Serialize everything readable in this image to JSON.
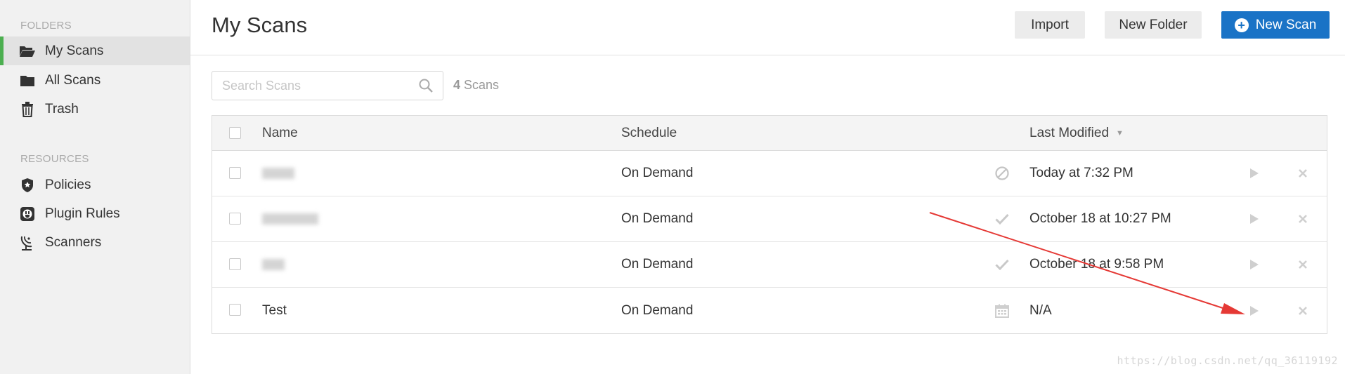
{
  "sidebar": {
    "folders_title": "FOLDERS",
    "resources_title": "RESOURCES",
    "folders": [
      {
        "label": "My Scans",
        "icon": "folder-open-icon",
        "active": true
      },
      {
        "label": "All Scans",
        "icon": "folder-icon",
        "active": false
      },
      {
        "label": "Trash",
        "icon": "trash-icon",
        "active": false
      }
    ],
    "resources": [
      {
        "label": "Policies",
        "icon": "shield-star-icon"
      },
      {
        "label": "Plugin Rules",
        "icon": "plug-icon"
      },
      {
        "label": "Scanners",
        "icon": "satellite-dish-icon"
      }
    ]
  },
  "header": {
    "title": "My Scans",
    "import_label": "Import",
    "new_folder_label": "New Folder",
    "new_scan_label": "New Scan"
  },
  "search": {
    "placeholder": "Search Scans",
    "value": "",
    "count_number": "4",
    "count_suffix": "Scans"
  },
  "table": {
    "columns": {
      "name": "Name",
      "schedule": "Schedule",
      "last_modified": "Last Modified"
    },
    "rows": [
      {
        "name": "",
        "schedule": "On Demand",
        "status_icon": "disabled-icon",
        "last_modified": "Today at 7:32 PM"
      },
      {
        "name": "",
        "schedule": "On Demand",
        "status_icon": "checkmark-icon",
        "last_modified": "October 18 at 10:27 PM"
      },
      {
        "name": "",
        "schedule": "On Demand",
        "status_icon": "checkmark-icon",
        "last_modified": "October 18 at 9:58 PM"
      },
      {
        "name": "Test",
        "schedule": "On Demand",
        "status_icon": "calendar-icon",
        "last_modified": "N/A"
      }
    ]
  },
  "colors": {
    "accent_green": "#4caf50",
    "button_blue": "#1a73c6",
    "annotation_red": "#e53935"
  },
  "watermark": "https://blog.csdn.net/qq_36119192"
}
